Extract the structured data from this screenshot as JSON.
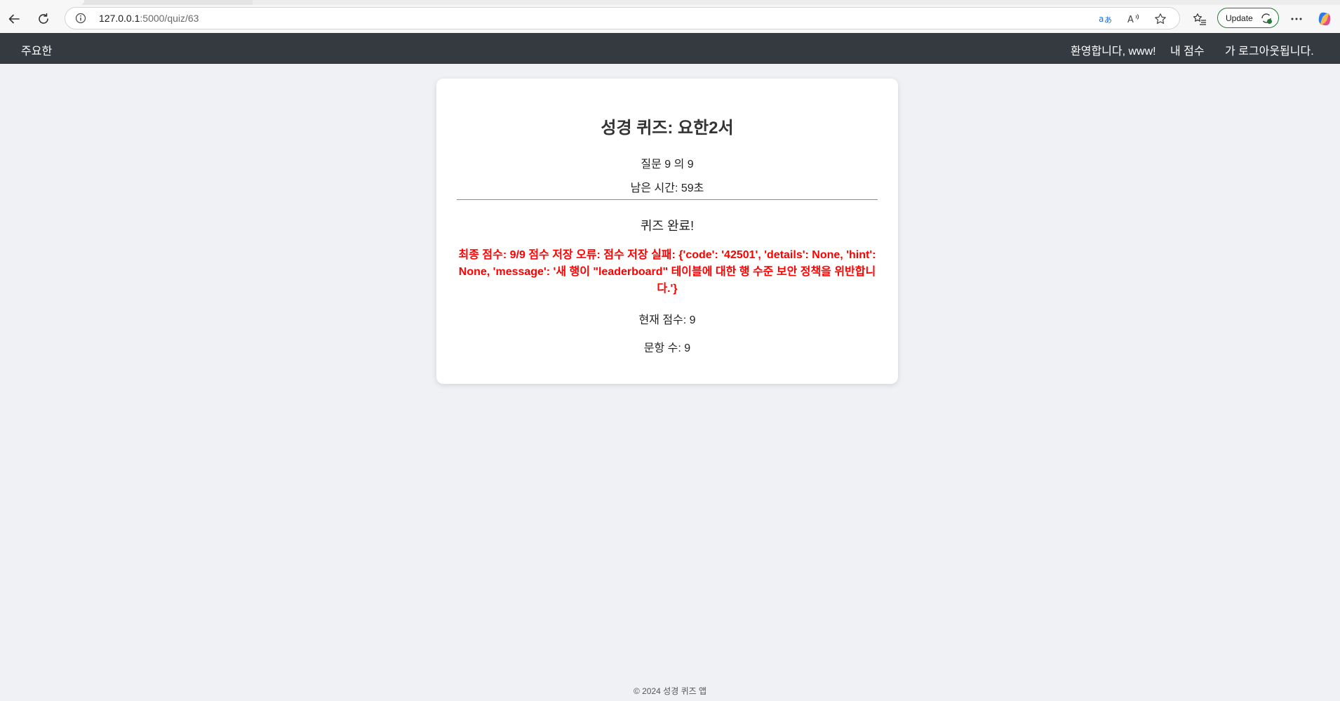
{
  "browser": {
    "url_host": "127.0.0.1",
    "url_path": ":5000/quiz/63",
    "update_label": "Update",
    "icons": [
      "back-arrow-icon",
      "refresh-icon",
      "info-icon",
      "translate-icon",
      "read-aloud-icon",
      "favorite-star-icon",
      "favorites-list-icon",
      "update-sync-icon",
      "more-options-icon",
      "copilot-icon"
    ]
  },
  "nav": {
    "brand": "주요한",
    "welcome": "환영합니다, www!",
    "my_score": "내 점수",
    "logout": "가 로그아웃됩니다."
  },
  "quiz": {
    "title": "성경 퀴즈: 요한2서",
    "progress": "질문 9 의 9",
    "timer": "남은 시간: 59초",
    "complete": "퀴즈 완료!",
    "error": "최종 점수: 9/9 점수 저장 오류: 점수 저장 실패: {'code': '42501', 'details': None, 'hint': None, 'message': '새 행이 \"leaderboard\" 테이블에 대한 행 수준 보안 정책을 위반합니다.'}",
    "current_score": "현재 점수: 9",
    "question_count": "문항 수: 9"
  },
  "footer": {
    "text": "© 2024 성경 퀴즈 앱"
  },
  "colors": {
    "nav_bg": "#343a40",
    "page_bg": "#eff1f4",
    "error": "#ff0000",
    "update_border": "#1e7d32"
  }
}
